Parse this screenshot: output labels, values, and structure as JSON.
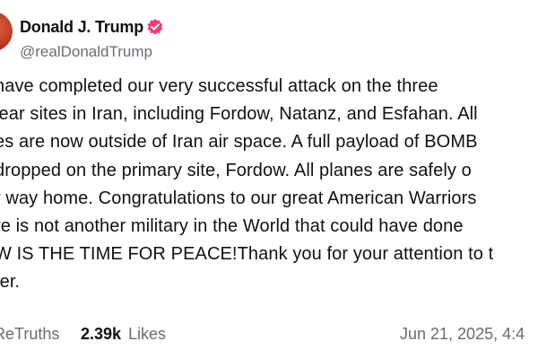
{
  "author": {
    "display_name": "Donald J. Trump",
    "handle": "@realDonaldTrump",
    "verified_icon": "verified-badge-icon",
    "verified_color": "#ee3d72"
  },
  "post": {
    "lines": [
      "have completed our very successful attack on the three",
      "lear sites in Iran, including Fordow, Natanz, and Esfahan. All",
      "es are now outside of Iran air space. A full payload of BOMB",
      "dropped on the primary site, Fordow. All planes are safely o",
      "r way home. Congratulations to our great American Warriors",
      "re is not another military in the World that could have done",
      "W IS THE TIME FOR PEACE!Thank you for your attention to t",
      "ter."
    ]
  },
  "footer": {
    "retruths_label": "ReTruths",
    "likes_count": "2.39k",
    "likes_label": "Likes",
    "timestamp": "Jun 21, 2025, 4:4"
  },
  "colors": {
    "text": "#111111",
    "muted": "#6b6b73",
    "background": "#ffffff"
  }
}
